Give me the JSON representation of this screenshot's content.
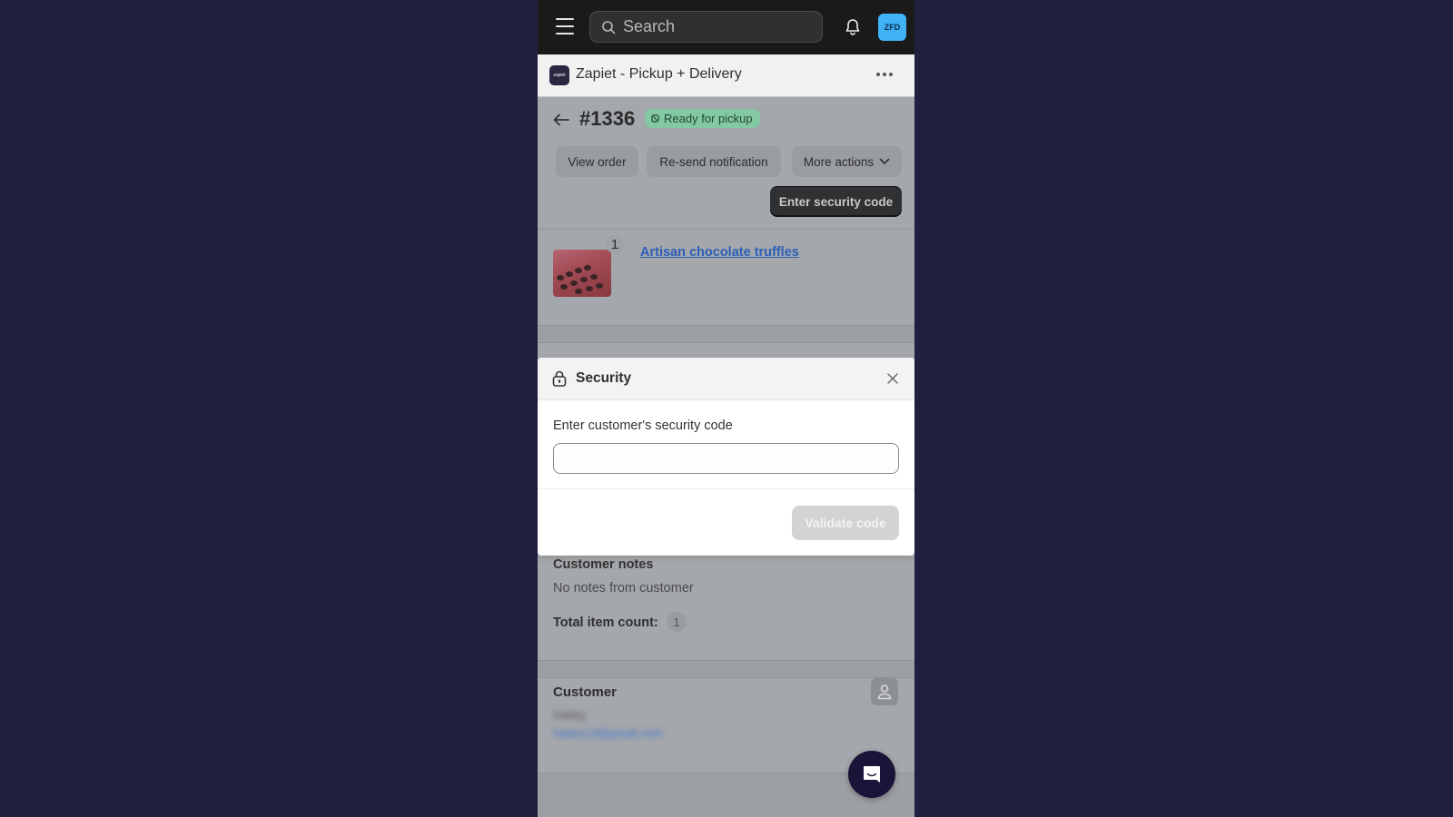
{
  "topbar": {
    "search_placeholder": "Search",
    "avatar_initials": "ZFD",
    "avatar_color": "#3fb3f5"
  },
  "app": {
    "logo_text": "zapiet",
    "title": "Zapiet - Pickup + Delivery"
  },
  "order": {
    "number": "#1336",
    "status": "Ready for pickup",
    "status_color": "#84c7a3",
    "actions": {
      "view_order": "View order",
      "resend_notification": "Re-send notification",
      "more_actions": "More actions",
      "enter_security_code": "Enter security code"
    },
    "line_items": [
      {
        "name": "Artisan chocolate truffles",
        "quantity": "1"
      }
    ],
    "customer_notes": {
      "heading": "Customer notes",
      "value": "No notes from customer"
    },
    "total_item_count": {
      "label": "Total item count:",
      "value": "1"
    },
    "customer": {
      "heading": "Customer",
      "name": "Hailey",
      "email": "hailey13@gmail.com"
    }
  },
  "modal": {
    "title": "Security",
    "field_label": "Enter customer's security code",
    "field_value": "",
    "field_placeholder": "",
    "validate_label": "Validate code",
    "validate_enabled": false
  }
}
